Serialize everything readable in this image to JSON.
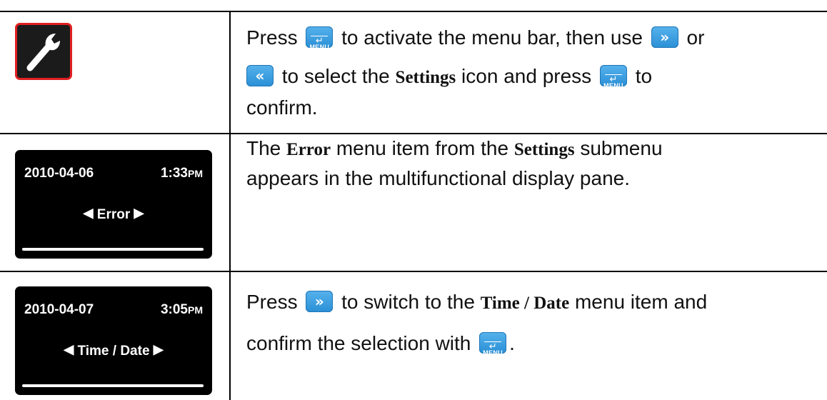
{
  "icons": {
    "menu_label": "MENU",
    "menu_return": "↵",
    "right_arrow": "»",
    "left_arrow": "«"
  },
  "rows": [
    {
      "icon": "wrench-icon",
      "parts": {
        "p1": "Press ",
        "p2": " to activate the menu bar, then use ",
        "p3": " or",
        "p4": " to select the ",
        "p5": "Settings",
        "p6": " icon and press ",
        "p7": " to",
        "p8": "confirm."
      }
    },
    {
      "screen": {
        "date": "2010-04-06",
        "time": "1:33",
        "ampm": "PM",
        "item": "Error"
      },
      "parts": {
        "p1": "The ",
        "p2": "Error",
        "p3": " menu item from the ",
        "p4": "Settings",
        "p5": " submenu",
        "p6": "appears in the multifunctional display pane."
      }
    },
    {
      "screen": {
        "date": "2010-04-07",
        "time": "3:05",
        "ampm": "PM",
        "item": "Time / Date"
      },
      "parts": {
        "p1": "Press ",
        "p2": " to switch to the ",
        "p3": "Time / Date",
        "p4": " menu item and",
        "p5": "confirm the selection with ",
        "p6": "."
      }
    }
  ],
  "colors": {
    "button_blue": "#3a9fe0",
    "wrench_border": "#e02020",
    "screen_bg": "#000000"
  }
}
